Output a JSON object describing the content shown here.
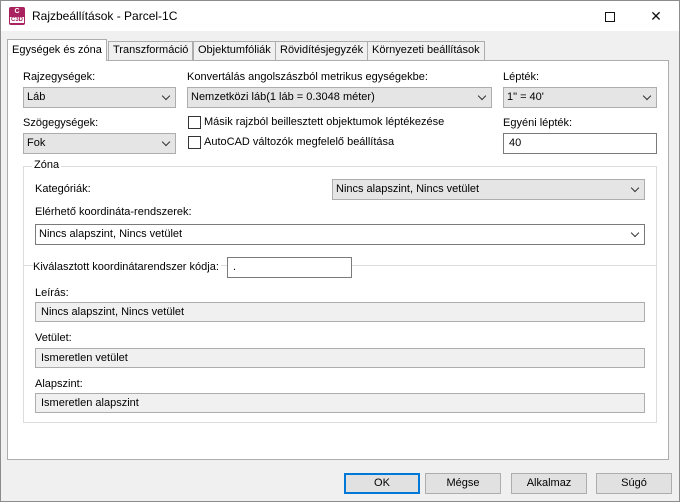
{
  "window": {
    "title": "Rajzbeállítások - Parcel-1C",
    "app_icon_top": "C",
    "app_icon_bottom": "C3D"
  },
  "tabs": [
    {
      "label": "Egységek és zóna"
    },
    {
      "label": "Transzformáció"
    },
    {
      "label": "Objektumfóliák"
    },
    {
      "label": "Rövidítésjegyzék"
    },
    {
      "label": "Környezeti beállítások"
    }
  ],
  "units": {
    "drawing_units_label": "Rajzegységek:",
    "drawing_units_value": "Láb",
    "angle_units_label": "Szögegységek:",
    "angle_units_value": "Fok",
    "convert_label": "Konvertálás angolszászból metrikus egységekbe:",
    "convert_value": "Nemzetközi láb(1 láb = 0.3048 méter)",
    "scale_ins_label": "Másik rajzból beillesztett objektumok léptékezése",
    "autocad_vars_label": "AutoCAD változók megfelelő beállítása",
    "scale_label": "Lépték:",
    "scale_value": "1\" = 40'",
    "custom_scale_label": "Egyéni lépték:",
    "custom_scale_value": "40"
  },
  "zone": {
    "title": "Zóna",
    "categories_label": "Kategóriák:",
    "categories_value": "Nincs alapszint, Nincs vetület",
    "available_cs_label": "Elérhető koordináta-rendszerek:",
    "available_cs_value": "Nincs alapszint, Nincs vetület",
    "selected_code_label": "Kiválasztott koordinátarendszer kódja:",
    "selected_code_value": ".",
    "description_label": "Leírás:",
    "description_value": "Nincs alapszint, Nincs vetület",
    "projection_label": "Vetület:",
    "projection_value": "Ismeretlen vetület",
    "datum_label": "Alapszint:",
    "datum_value": "Ismeretlen alapszint"
  },
  "buttons": {
    "ok": "OK",
    "cancel": "Mégse",
    "apply": "Alkalmaz",
    "help": "Súgó"
  }
}
